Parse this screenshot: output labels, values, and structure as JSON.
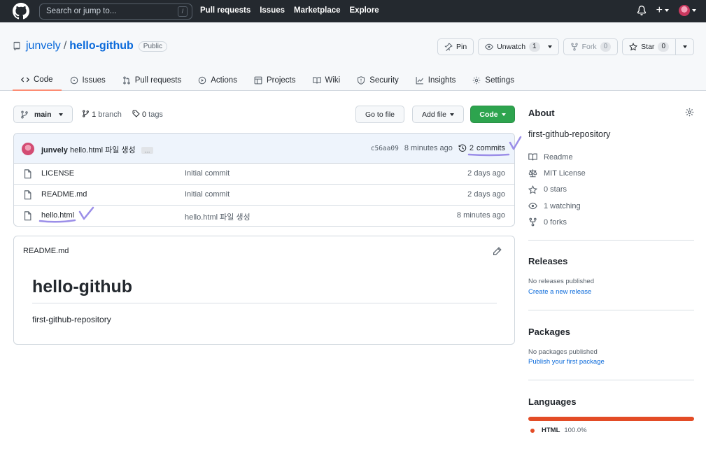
{
  "header": {
    "search_placeholder": "Search or jump to...",
    "search_shortcut": "/",
    "nav": [
      "Pull requests",
      "Issues",
      "Marketplace",
      "Explore"
    ]
  },
  "repo": {
    "owner": "junvely",
    "separator": "/",
    "name": "hello-github",
    "visibility": "Public",
    "actions": {
      "pin": "Pin",
      "unwatch": "Unwatch",
      "unwatch_count": "1",
      "fork": "Fork",
      "fork_count": "0",
      "star": "Star",
      "star_count": "0"
    },
    "tabs": [
      {
        "label": "Code",
        "icon": "code-icon"
      },
      {
        "label": "Issues",
        "icon": "issue-icon"
      },
      {
        "label": "Pull requests",
        "icon": "pull-request-icon"
      },
      {
        "label": "Actions",
        "icon": "play-icon"
      },
      {
        "label": "Projects",
        "icon": "table-icon"
      },
      {
        "label": "Wiki",
        "icon": "book-icon"
      },
      {
        "label": "Security",
        "icon": "shield-icon"
      },
      {
        "label": "Insights",
        "icon": "graph-icon"
      },
      {
        "label": "Settings",
        "icon": "gear-icon"
      }
    ]
  },
  "toolbar": {
    "branch": "main",
    "branches_count": "1",
    "branches_label": "branch",
    "tags_count": "0",
    "tags_label": "tags",
    "goto_file": "Go to file",
    "add_file": "Add file",
    "code": "Code"
  },
  "commit": {
    "author": "junvely",
    "message": "hello.html 파일 생성",
    "ellipsis": "…",
    "sha": "c56aa09",
    "time": "8 minutes ago",
    "commits_count": "2",
    "commits_label": "commits"
  },
  "files": [
    {
      "name": "LICENSE",
      "message": "Initial commit",
      "date": "2 days ago"
    },
    {
      "name": "README.md",
      "message": "Initial commit",
      "date": "2 days ago"
    },
    {
      "name": "hello.html",
      "message": "hello.html 파일 생성",
      "date": "8 minutes ago"
    }
  ],
  "readme": {
    "filename": "README.md",
    "heading": "hello-github",
    "body": "first-github-repository"
  },
  "about": {
    "title": "About",
    "description": "first-github-repository",
    "items": [
      {
        "label": "Readme",
        "icon": "book-icon"
      },
      {
        "label": "MIT License",
        "icon": "law-icon"
      },
      {
        "label": "0 stars",
        "icon": "star-icon"
      },
      {
        "label": "1 watching",
        "icon": "eye-icon"
      },
      {
        "label": "0 forks",
        "icon": "fork-icon"
      }
    ]
  },
  "releases": {
    "title": "Releases",
    "text": "No releases published",
    "link": "Create a new release"
  },
  "packages": {
    "title": "Packages",
    "text": "No packages published",
    "link": "Publish your first package"
  },
  "languages": {
    "title": "Languages",
    "items": [
      {
        "name": "HTML",
        "percent": "100.0%",
        "fraction": 1.0,
        "color": "#e34c26"
      }
    ]
  },
  "colors": {
    "header_bg": "#24292f",
    "link": "#0969da",
    "primary_button": "#2da44e",
    "active_tab_underline": "#fd8c73",
    "annotation": "#9b8ee8"
  }
}
